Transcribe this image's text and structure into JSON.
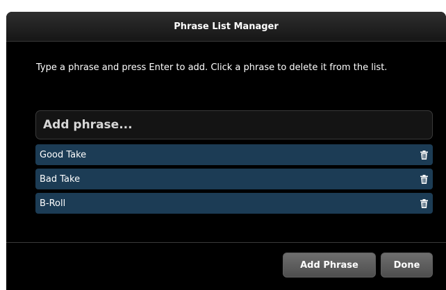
{
  "dialog": {
    "title": "Phrase List Manager",
    "instructions": "Type a phrase and press Enter to add. Click a phrase to delete it from the list.",
    "input": {
      "placeholder": "Add phrase...",
      "value": ""
    },
    "phrases": [
      {
        "label": "Good Take",
        "icon": "trash-icon"
      },
      {
        "label": "Bad Take",
        "icon": "trash-icon"
      },
      {
        "label": "B-Roll",
        "icon": "trash-icon"
      }
    ],
    "buttons": {
      "add_label": "Add Phrase",
      "done_label": "Done"
    }
  },
  "colors": {
    "background": "#000000",
    "phrase_item": "#1c3c55",
    "button": "#5e5e5e",
    "text": "#ffffff"
  }
}
